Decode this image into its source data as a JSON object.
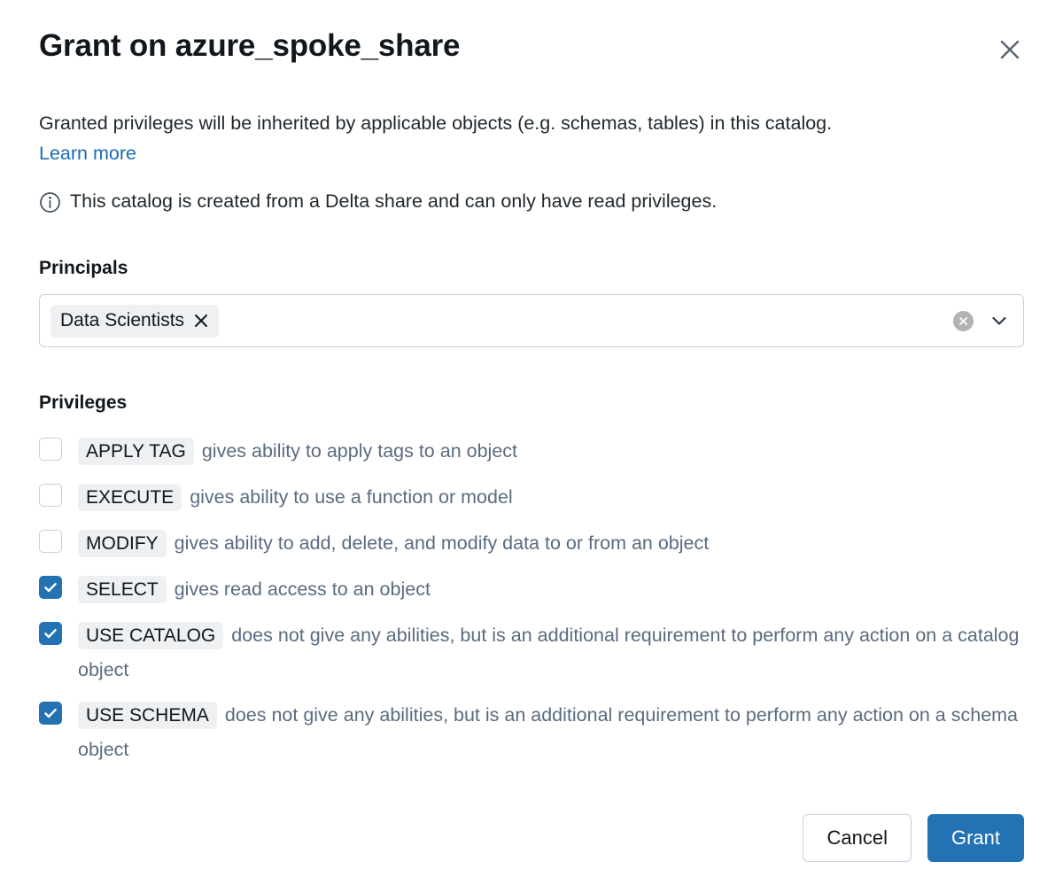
{
  "dialog": {
    "title": "Grant on azure_spoke_share",
    "close_label": "close-icon",
    "description": "Granted privileges will be inherited by applicable objects (e.g. schemas, tables) in this catalog.",
    "learn_more": "Learn more",
    "info_message": "This catalog is created from a Delta share and can only have read privileges."
  },
  "principals": {
    "label": "Principals",
    "chips": [
      {
        "label": "Data Scientists"
      }
    ],
    "clear_label": "clear",
    "expand_label": "expand"
  },
  "privileges": {
    "label": "Privileges",
    "items": [
      {
        "name": "APPLY TAG",
        "description": "gives ability to apply tags to an object",
        "checked": false
      },
      {
        "name": "EXECUTE",
        "description": "gives ability to use a function or model",
        "checked": false
      },
      {
        "name": "MODIFY",
        "description": "gives ability to add, delete, and modify data to or from an object",
        "checked": false
      },
      {
        "name": "SELECT",
        "description": "gives read access to an object",
        "checked": true
      },
      {
        "name": "USE CATALOG",
        "description": "does not give any abilities, but is an additional requirement to perform any action on a catalog object",
        "checked": true
      },
      {
        "name": "USE SCHEMA",
        "description": "does not give any abilities, but is an additional requirement to perform any action on a schema object",
        "checked": true
      }
    ]
  },
  "footer": {
    "cancel_label": "Cancel",
    "grant_label": "Grant"
  },
  "colors": {
    "accent": "#2272b4",
    "link": "#1b6cb5",
    "description_text": "#5a6b80",
    "badge_bg": "#eef0f2",
    "border": "#c4d2de"
  }
}
